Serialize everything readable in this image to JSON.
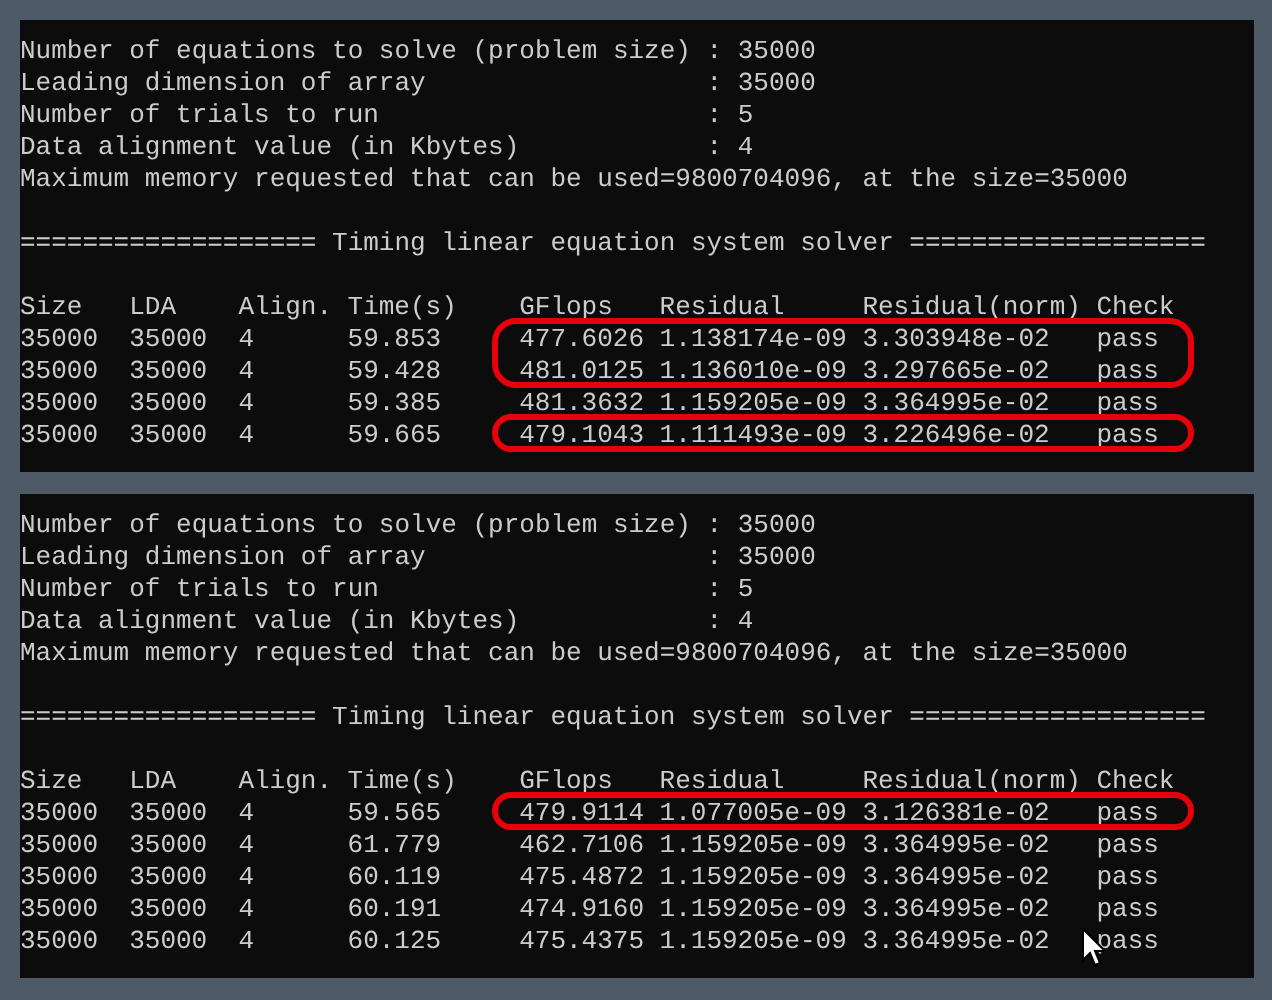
{
  "panels": [
    {
      "info_lines": [
        "Number of equations to solve (problem size) : 35000",
        "Leading dimension of array                  : 35000",
        "Number of trials to run                     : 5",
        "Data alignment value (in Kbytes)            : 4",
        "Maximum memory requested that can be used=9800704096, at the size=35000"
      ],
      "separator": "=================== Timing linear equation system solver ===================",
      "table": {
        "columns": [
          "Size",
          "LDA",
          "Align.",
          "Time(s)",
          "GFlops",
          "Residual",
          "Residual(norm)",
          "Check"
        ],
        "rows": [
          {
            "cells": [
              "35000",
              "35000",
              "4",
              "59.853",
              "477.6026",
              "1.138174e-09",
              "3.303948e-02",
              "pass"
            ],
            "highlighted": true
          },
          {
            "cells": [
              "35000",
              "35000",
              "4",
              "59.428",
              "481.0125",
              "1.136010e-09",
              "3.297665e-02",
              "pass"
            ],
            "highlighted": true
          },
          {
            "cells": [
              "35000",
              "35000",
              "4",
              "59.385",
              "481.3632",
              "1.159205e-09",
              "3.364995e-02",
              "pass"
            ],
            "highlighted": false
          },
          {
            "cells": [
              "35000",
              "35000",
              "4",
              "59.665",
              "479.1043",
              "1.111493e-09",
              "3.226496e-02",
              "pass"
            ],
            "highlighted": true
          }
        ]
      }
    },
    {
      "info_lines": [
        "Number of equations to solve (problem size) : 35000",
        "Leading dimension of array                  : 35000",
        "Number of trials to run                     : 5",
        "Data alignment value (in Kbytes)            : 4",
        "Maximum memory requested that can be used=9800704096, at the size=35000"
      ],
      "separator": "=================== Timing linear equation system solver ===================",
      "table": {
        "columns": [
          "Size",
          "LDA",
          "Align.",
          "Time(s)",
          "GFlops",
          "Residual",
          "Residual(norm)",
          "Check"
        ],
        "rows": [
          {
            "cells": [
              "35000",
              "35000",
              "4",
              "59.565",
              "479.9114",
              "1.077005e-09",
              "3.126381e-02",
              "pass"
            ],
            "highlighted": true
          },
          {
            "cells": [
              "35000",
              "35000",
              "4",
              "61.779",
              "462.7106",
              "1.159205e-09",
              "3.364995e-02",
              "pass"
            ],
            "highlighted": false
          },
          {
            "cells": [
              "35000",
              "35000",
              "4",
              "60.119",
              "475.4872",
              "1.159205e-09",
              "3.364995e-02",
              "pass"
            ],
            "highlighted": false
          },
          {
            "cells": [
              "35000",
              "35000",
              "4",
              "60.191",
              "474.9160",
              "1.159205e-09",
              "3.364995e-02",
              "pass"
            ],
            "highlighted": false
          },
          {
            "cells": [
              "35000",
              "35000",
              "4",
              "60.125",
              "475.4375",
              "1.159205e-09",
              "3.364995e-02",
              "pass"
            ],
            "highlighted": false
          }
        ]
      }
    }
  ]
}
